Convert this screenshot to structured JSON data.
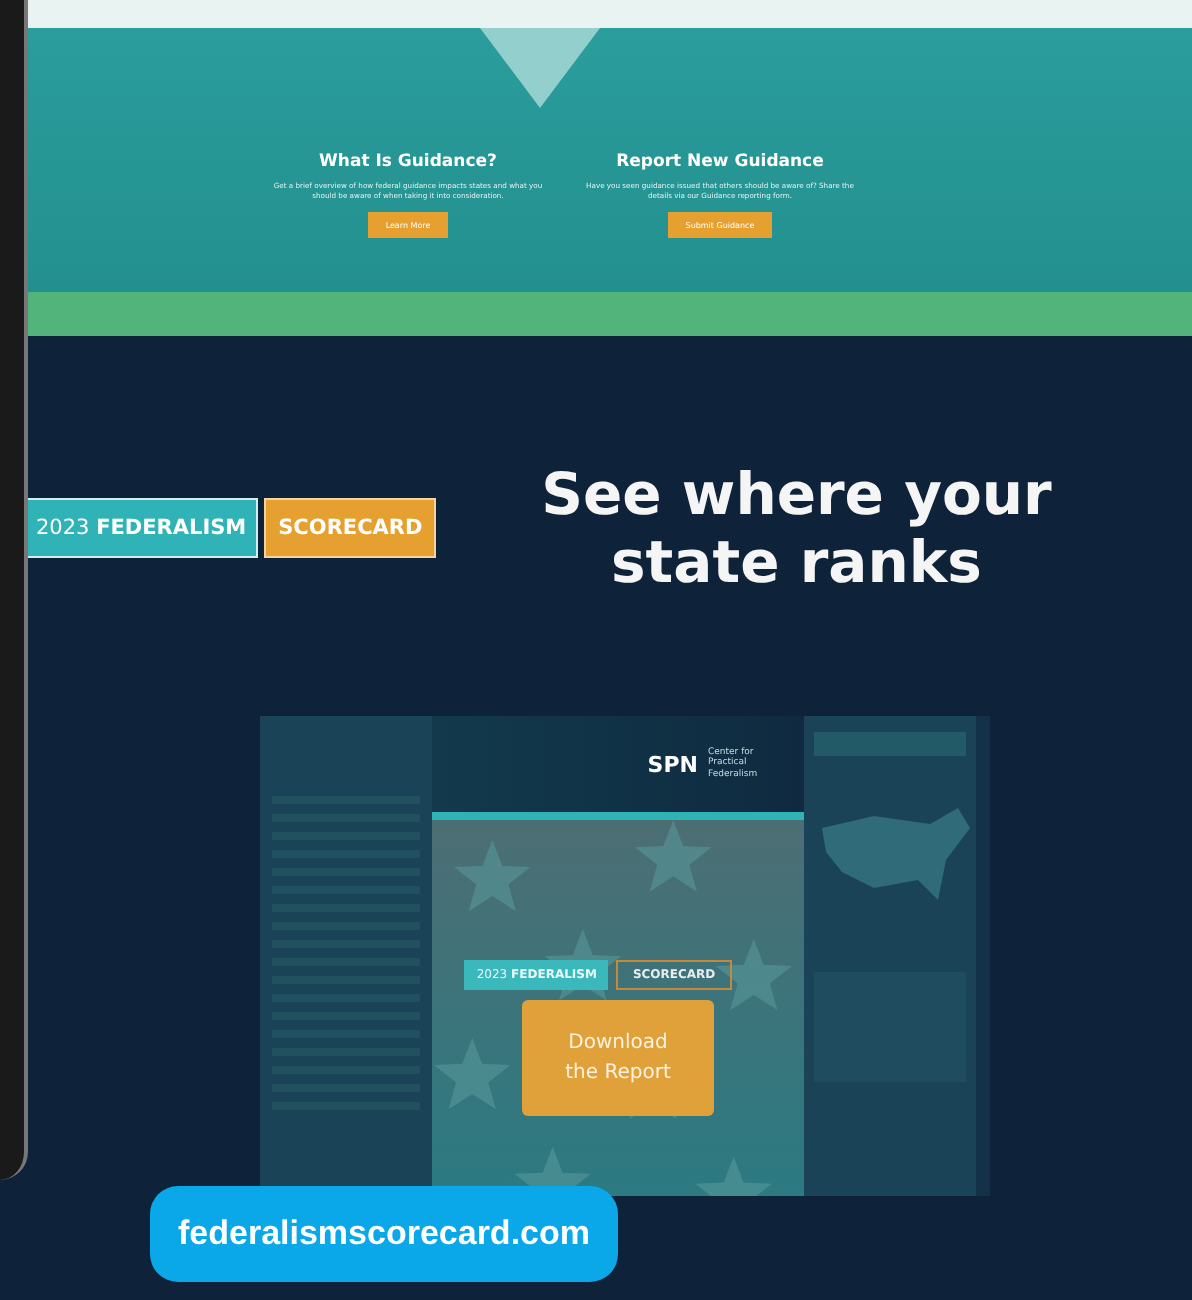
{
  "guidance_cards": [
    {
      "title": "What Is Guidance?",
      "text": "Get a brief overview of how federal guidance impacts states and what you should be aware of when taking it into consideration.",
      "button": "Learn More"
    },
    {
      "title": "Report New Guidance",
      "text": "Have you seen guidance issued that others should be aware of? Share the details via our Guidance reporting form.",
      "button": "Submit Guidance"
    }
  ],
  "hero": {
    "badge_primary": "2023 **FEDERALISM**",
    "badge_secondary": "SCORECARD",
    "heading": "See where your state ranks"
  },
  "report_preview": {
    "logo": "SPN",
    "org_name": "Center for Practical Federalism",
    "badge_primary": "2023 **FEDERALISM**",
    "badge_secondary": "SCORECARD",
    "button": "Download the Report"
  },
  "url_badge": "federalismscorecard.com"
}
